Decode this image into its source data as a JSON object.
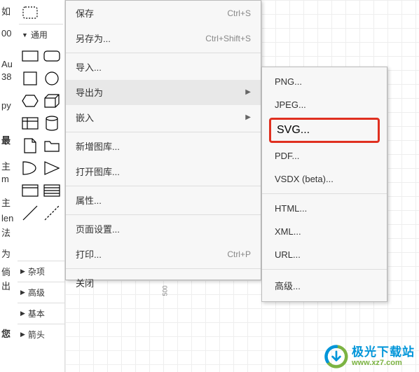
{
  "bg_text": [
    "如",
    "00",
    "Au",
    "38",
    "py",
    "最",
    "主",
    "m",
    "主",
    "len",
    "法",
    "为",
    "倘",
    "出",
    "您"
  ],
  "sidebar": {
    "general_label": "通用",
    "categories": [
      "杂项",
      "高级",
      "基本",
      "箭头"
    ]
  },
  "menu": {
    "save": {
      "label": "保存",
      "shortcut": "Ctrl+S"
    },
    "save_as": {
      "label": "另存为...",
      "shortcut": "Ctrl+Shift+S"
    },
    "import": {
      "label": "导入..."
    },
    "export_as": {
      "label": "导出为"
    },
    "embed": {
      "label": "嵌入"
    },
    "new_library": {
      "label": "新增图库..."
    },
    "open_library": {
      "label": "打开图库..."
    },
    "properties": {
      "label": "属性..."
    },
    "page_setup": {
      "label": "页面设置..."
    },
    "print": {
      "label": "打印...",
      "shortcut": "Ctrl+P"
    },
    "close": {
      "label": "关闭"
    }
  },
  "submenu": {
    "png": "PNG...",
    "jpeg": "JPEG...",
    "svg": "SVG...",
    "pdf": "PDF...",
    "vsdx": "VSDX (beta)...",
    "html": "HTML...",
    "xml": "XML...",
    "url": "URL...",
    "advanced": "高级..."
  },
  "ruler": {
    "label": "500"
  },
  "watermark": {
    "title": "极光下载站",
    "url": "www.xz7.com"
  }
}
